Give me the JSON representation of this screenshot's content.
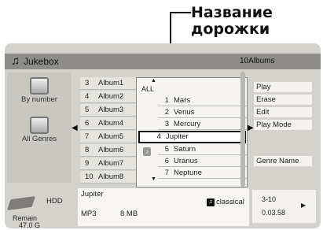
{
  "callout": {
    "line1": "Название",
    "line2": "дорожки"
  },
  "header": {
    "title": "Jukebox",
    "album_count": "10Albums"
  },
  "nav": {
    "by_number": "By number",
    "all_genres": "All Genres"
  },
  "albums": [
    {
      "num": "3",
      "name": "Album1"
    },
    {
      "num": "4",
      "name": "Album2"
    },
    {
      "num": "5",
      "name": "Album3"
    },
    {
      "num": "6",
      "name": "Album4"
    },
    {
      "num": "7",
      "name": "Album5"
    },
    {
      "num": "8",
      "name": "Album6"
    },
    {
      "num": "9",
      "name": "Album7"
    },
    {
      "num": "10",
      "name": "Album8"
    }
  ],
  "tracks": {
    "all_label": "ALL",
    "items": [
      {
        "num": "1",
        "name": "Mars"
      },
      {
        "num": "2",
        "name": "Venus"
      },
      {
        "num": "3",
        "name": "Mercury"
      },
      {
        "num": "4",
        "name": "Jupiter"
      },
      {
        "num": "5",
        "name": "Saturn"
      },
      {
        "num": "6",
        "name": "Uranus"
      },
      {
        "num": "7",
        "name": "Neptune"
      }
    ],
    "selected_index": 3
  },
  "menu": {
    "play": "Play",
    "erase": "Erase",
    "edit": "Edit",
    "play_mode": "Play Mode",
    "genre_name": "Genre Name"
  },
  "info": {
    "track": "Jupiter",
    "format": "MP3",
    "size": "8 MB",
    "genre": "classical"
  },
  "storage": {
    "device": "HDD",
    "remain_label": "Remain",
    "remain_value": "47.0 G"
  },
  "playback": {
    "track_pos": "3-10",
    "elapsed": "0.03.58"
  }
}
